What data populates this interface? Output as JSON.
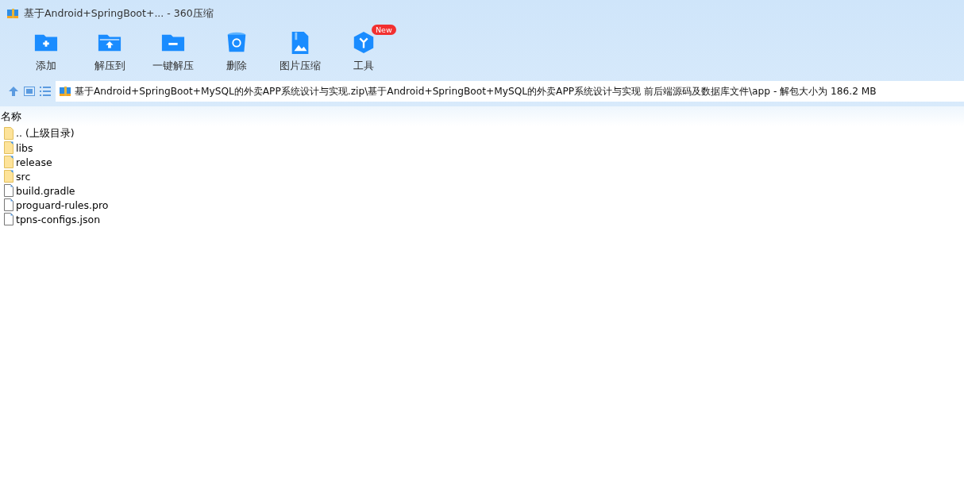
{
  "window": {
    "title": "基于Android+SpringBoot+... - 360压缩"
  },
  "toolbar": [
    {
      "kind": "add",
      "label": "添加"
    },
    {
      "kind": "extract",
      "label": "解压到"
    },
    {
      "kind": "quick",
      "label": "一键解压"
    },
    {
      "kind": "delete",
      "label": "删除"
    },
    {
      "kind": "image",
      "label": "图片压缩"
    },
    {
      "kind": "tools",
      "label": "工具",
      "badge": "New"
    }
  ],
  "address": {
    "path": "基于Android+SpringBoot+MySQL的外卖APP系统设计与实现.zip\\基于Android+SpringBoot+MySQL的外卖APP系统设计与实现 前后端源码及数据库文件\\app - 解包大小为 186.2 MB"
  },
  "list": {
    "column": "名称",
    "items": [
      {
        "kind": "parent",
        "name": ".. (上级目录)"
      },
      {
        "kind": "folder",
        "name": "libs"
      },
      {
        "kind": "folder",
        "name": "release"
      },
      {
        "kind": "folder",
        "name": "src"
      },
      {
        "kind": "file",
        "name": "build.gradle"
      },
      {
        "kind": "file",
        "name": "proguard-rules.pro"
      },
      {
        "kind": "file",
        "name": "tpns-configs.json"
      }
    ]
  }
}
